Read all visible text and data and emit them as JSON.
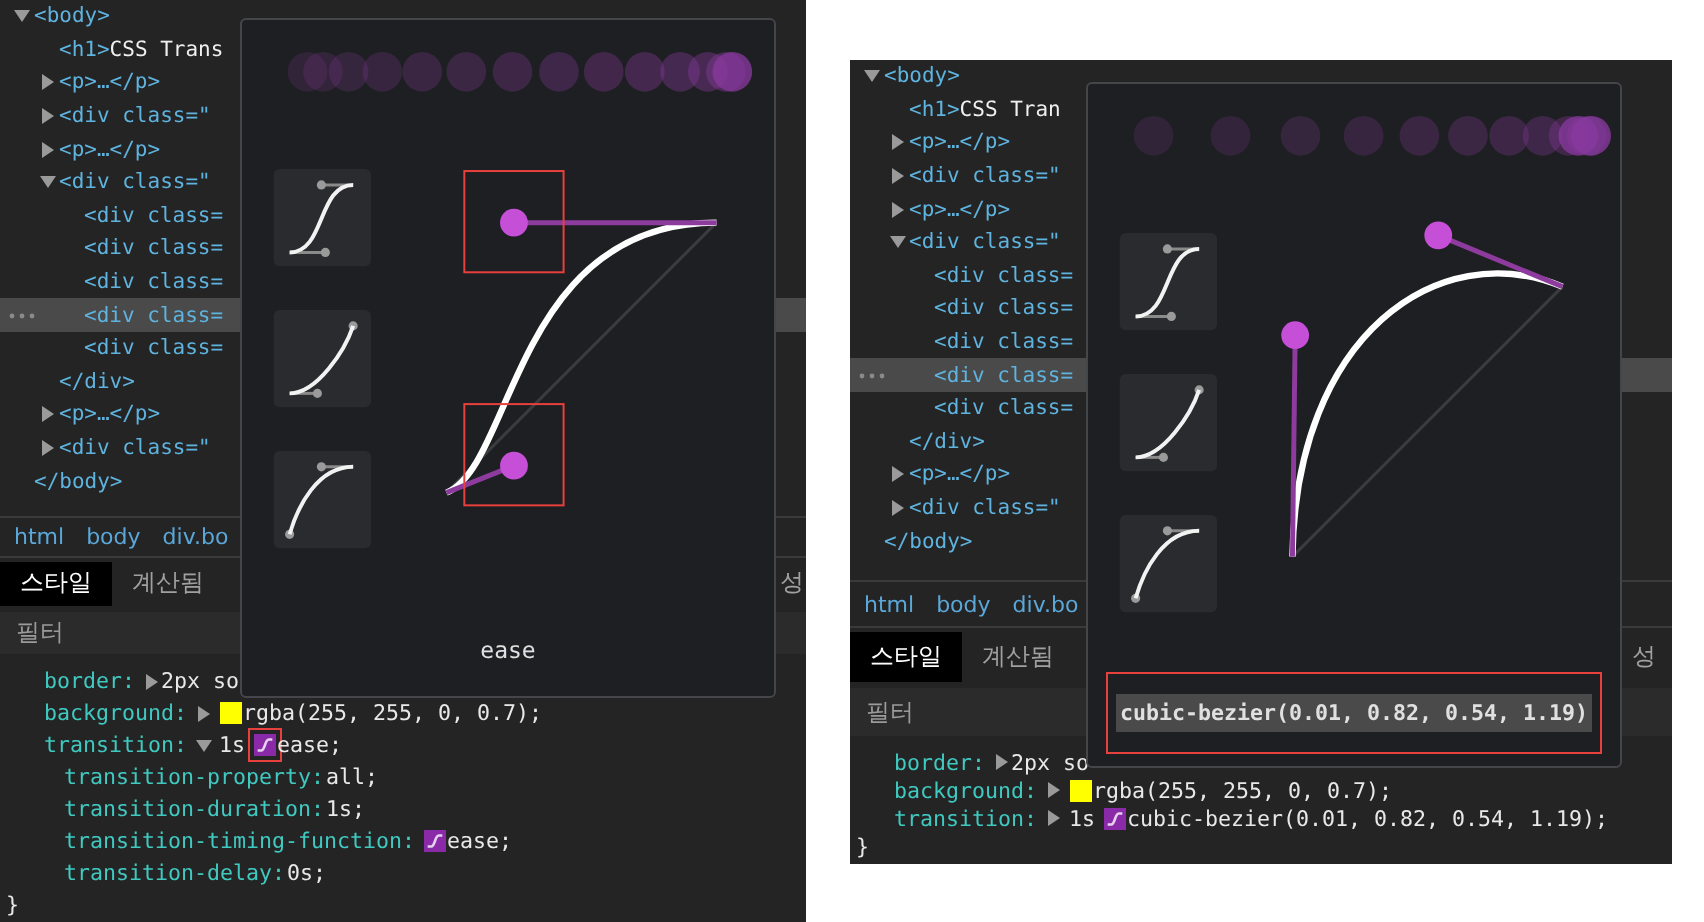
{
  "panels": [
    {
      "tree": [
        {
          "text": "<body>",
          "expanded": true,
          "selected": false,
          "closing": "</body>",
          "children": [
            {
              "text": "<h1>",
              "content": "CSS Trans",
              "selected": false
            },
            {
              "text": "<p>…</p>",
              "expanded": false,
              "selected": false
            },
            {
              "text": "<div class=\"",
              "expanded": false,
              "selected": false
            },
            {
              "text": "<p>…</p>",
              "expanded": false,
              "selected": false
            },
            {
              "text": "<div class=\"",
              "expanded": true,
              "selected": false,
              "closing": "</div>",
              "children": [
                {
                  "text": "<div class=",
                  "selected": false
                },
                {
                  "text": "<div class=",
                  "selected": false
                },
                {
                  "text": "<div class=",
                  "selected": false
                },
                {
                  "text": "<div class=",
                  "selected": true
                },
                {
                  "text": "<div class=",
                  "selected": false
                }
              ]
            },
            {
              "text": "<p>…</p>",
              "expanded": false,
              "selected": false
            },
            {
              "text": "<div class=\"",
              "expanded": false,
              "selected": false
            }
          ]
        }
      ],
      "breadcrumbs": [
        "html",
        "body",
        "div.bo"
      ],
      "tabs": [
        {
          "label": "스타일",
          "selected": true
        },
        {
          "label": "계산됨",
          "selected": false
        },
        {
          "label": "성",
          "selected": false
        }
      ],
      "filter": {
        "placeholder": "필터"
      },
      "rules": [
        {
          "name": "border:",
          "expanded": false,
          "value": "2px so"
        },
        {
          "name": "background:",
          "expanded": false,
          "swatch": {
            "kind": "color",
            "color": "#ffff00"
          },
          "value": "rgba(255, 255, 0, 0.7);"
        },
        {
          "name": "transition:",
          "expanded": true,
          "prefix": "1s",
          "swatch": {
            "kind": "easing",
            "highlighted": true
          },
          "value": "ease;",
          "children": [
            {
              "name": "transition-property:",
              "value": "all;"
            },
            {
              "name": "transition-duration:",
              "value": "1s;"
            },
            {
              "name": "transition-timing-function:",
              "swatch": {
                "kind": "easing",
                "highlighted": false
              },
              "value": "ease;"
            },
            {
              "name": "transition-delay:",
              "value": "0s;"
            }
          ]
        }
      ],
      "closing_brace": "}",
      "editor": {
        "kind": "ease",
        "label": "ease",
        "label_selected": false
      }
    },
    {
      "tree": [
        {
          "text": "<body>",
          "expanded": true,
          "selected": false,
          "closing": "</body>",
          "children": [
            {
              "text": "<h1>",
              "content": "CSS Tran",
              "selected": false
            },
            {
              "text": "<p>…</p>",
              "expanded": false,
              "selected": false
            },
            {
              "text": "<div class=\"",
              "expanded": false,
              "selected": false
            },
            {
              "text": "<p>…</p>",
              "expanded": false,
              "selected": false
            },
            {
              "text": "<div class=\"",
              "expanded": true,
              "selected": false,
              "closing": "</div>",
              "children": [
                {
                  "text": "<div class=",
                  "selected": false
                },
                {
                  "text": "<div class=",
                  "selected": false
                },
                {
                  "text": "<div class=",
                  "selected": false
                },
                {
                  "text": "<div class=",
                  "selected": true
                },
                {
                  "text": "<div class=",
                  "selected": false
                }
              ]
            },
            {
              "text": "<p>…</p>",
              "expanded": false,
              "selected": false
            },
            {
              "text": "<div class=\"",
              "expanded": false,
              "selected": false
            }
          ]
        }
      ],
      "breadcrumbs": [
        "html",
        "body",
        "div.bo"
      ],
      "tabs": [
        {
          "label": "스타일",
          "selected": true
        },
        {
          "label": "계산됨",
          "selected": false
        },
        {
          "label": "성",
          "selected": false
        }
      ],
      "filter": {
        "placeholder": "필터"
      },
      "rules": [
        {
          "name": "border:",
          "expanded": false,
          "value": "2px so"
        },
        {
          "name": "background:",
          "expanded": false,
          "swatch": {
            "kind": "color",
            "color": "#ffff00"
          },
          "value": "rgba(255, 255, 0, 0.7);"
        },
        {
          "name": "transition:",
          "expanded": false,
          "prefix": "1s",
          "swatch": {
            "kind": "easing",
            "highlighted": false
          },
          "value": "cubic-bezier(0.01, 0.82, 0.54, 1.19);"
        }
      ],
      "closing_brace": "}",
      "editor": {
        "kind": "bezier",
        "label": "cubic-bezier(0.01, 0.82, 0.54, 1.19)",
        "label_selected": true
      }
    }
  ]
}
